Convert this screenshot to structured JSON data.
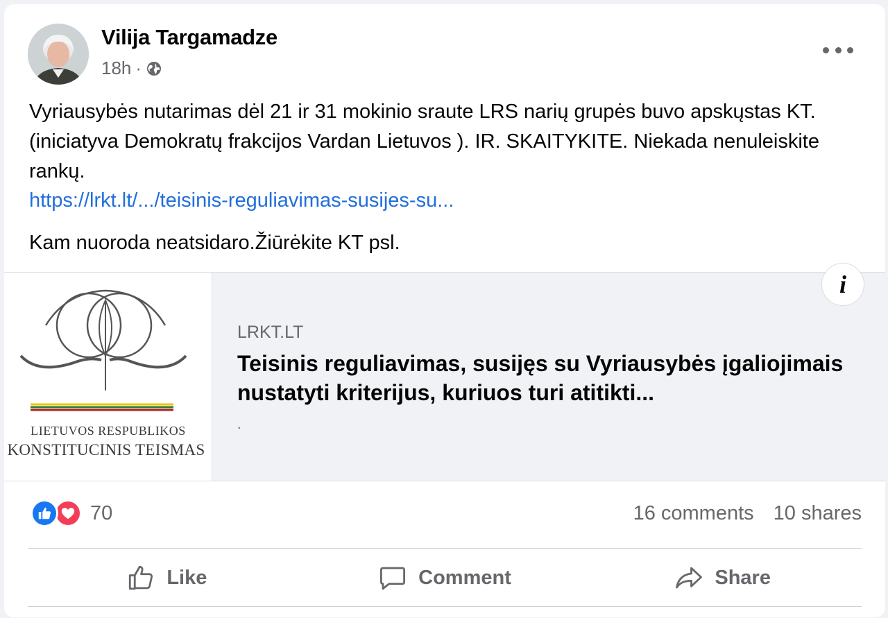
{
  "post": {
    "author": "Vilija Targamadze",
    "time": "18h",
    "separator": "·",
    "privacy_icon": "globe-icon",
    "text_main": "Vyriausybės nutarimas dėl 21 ir 31 mokinio sraute LRS narių grupės buvo apskųstas KT.(iniciatyva Demokratų frakcijos Vardan Lietuvos ). IR. SKAITYKITE. Niekada nenuleiskite rankų.",
    "link_text": "https://lrkt.lt/.../teisinis-reguliavimas-susijes-su...",
    "text_after": "Kam nuoroda neatsidaro.Žiūrėkite KT psl."
  },
  "preview": {
    "logo_line1": "LIETUVOS RESPUBLIKOS",
    "logo_line2": "KONSTITUCINIS TEISMAS",
    "domain": "LRKT.LT",
    "title": "Teisinis reguliavimas, susijęs su Vyriausybės įgaliojimais nustatyti kriterijus, kuriuos turi atitikti...",
    "description": ".",
    "info_label": "i"
  },
  "stats": {
    "reaction_count": "70",
    "comments": "16 comments",
    "shares": "10 shares"
  },
  "actions": {
    "like": "Like",
    "comment": "Comment",
    "share": "Share"
  },
  "colors": {
    "link": "#216fdb",
    "like_blue": "#1877f2",
    "love_red": "#f33e58",
    "secondary_text": "#65676b"
  }
}
